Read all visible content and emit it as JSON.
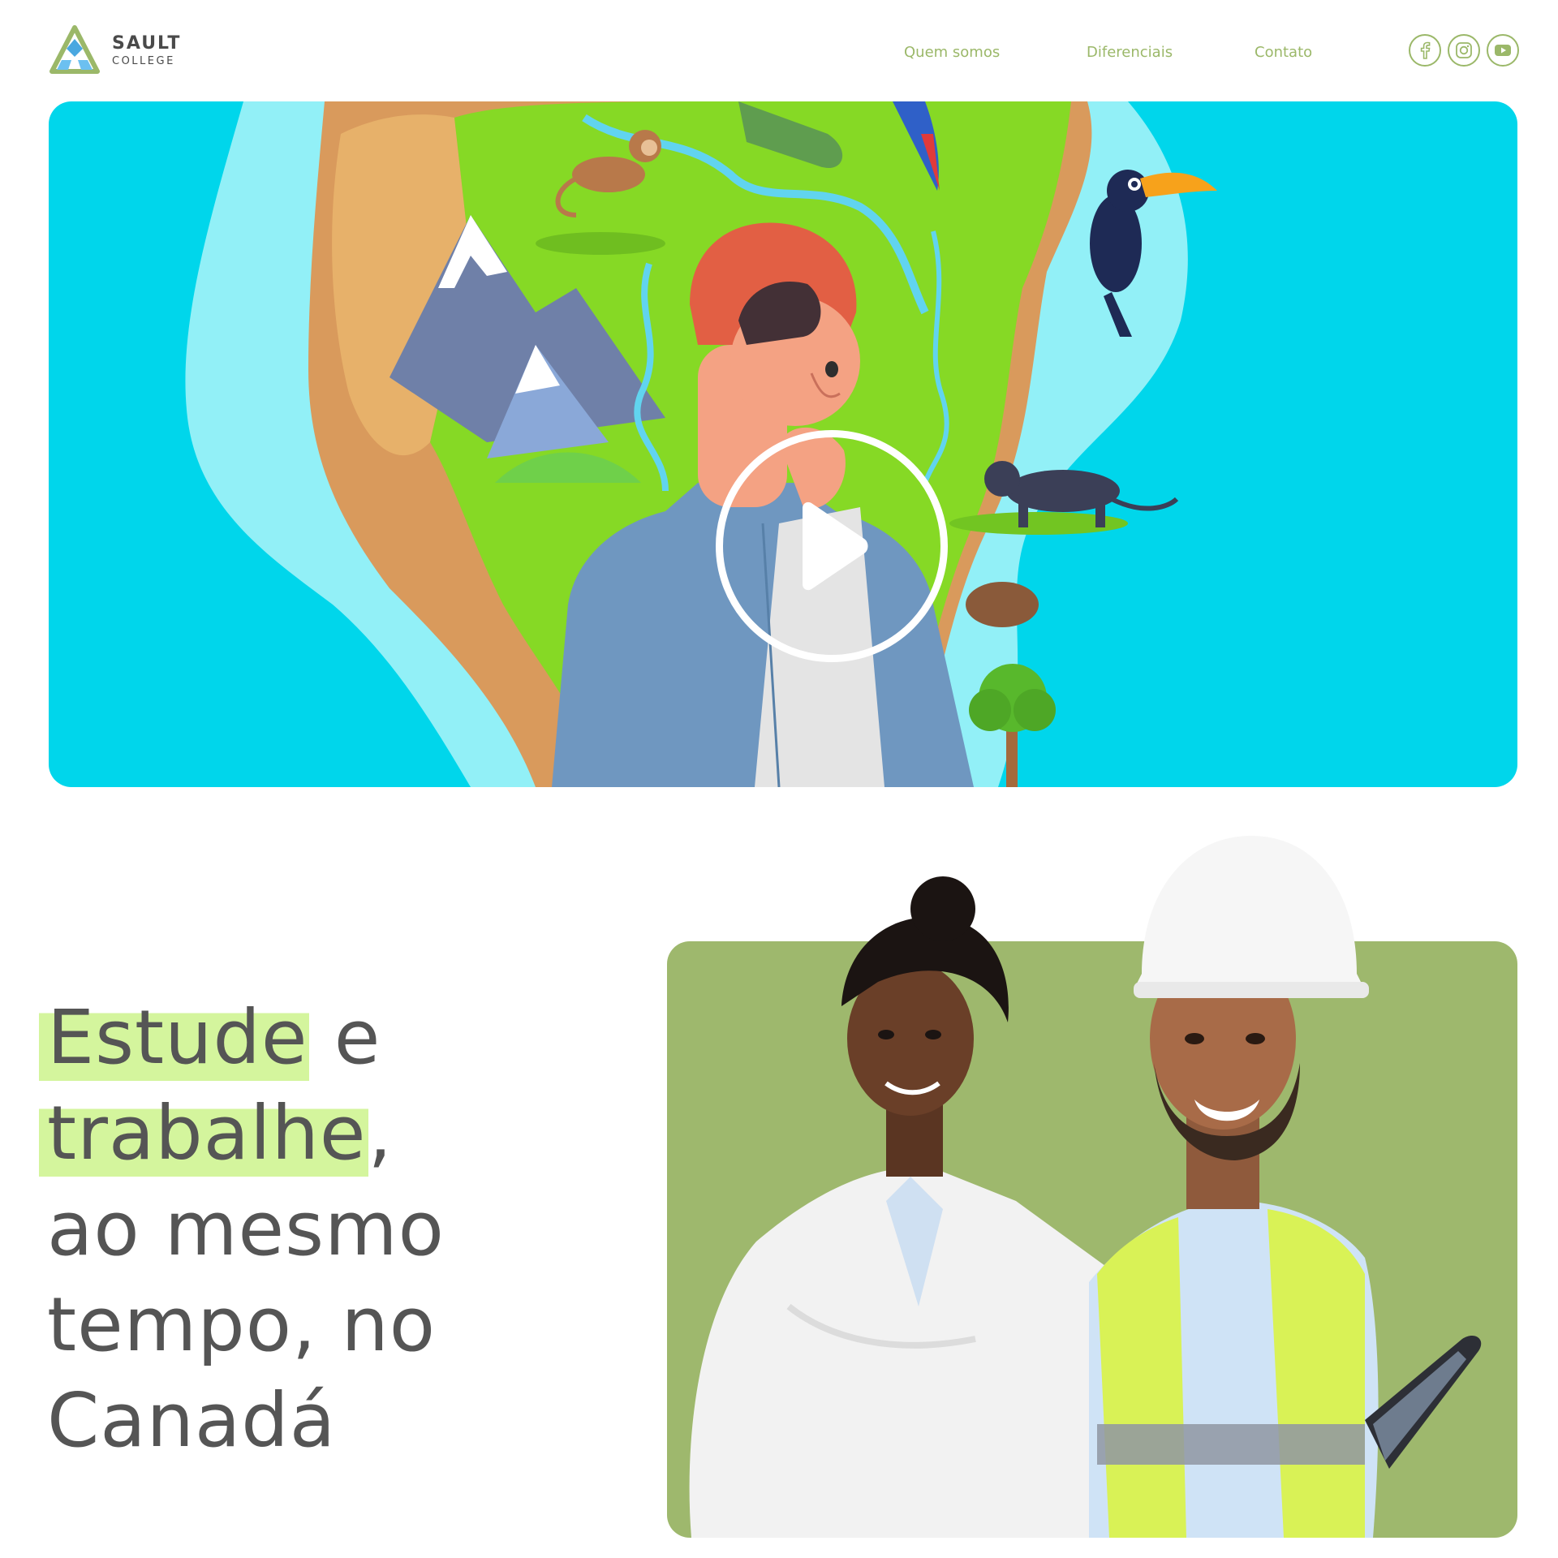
{
  "brand": {
    "name": "SAULT",
    "sub": "COLLEGE"
  },
  "nav": {
    "items": [
      {
        "label": "Quem somos"
      },
      {
        "label": "Diferenciais"
      },
      {
        "label": "Contato"
      }
    ]
  },
  "social": {
    "icons": [
      "facebook-icon",
      "instagram-icon",
      "youtube-icon"
    ],
    "color": "#9bb869"
  },
  "hero": {
    "background": "#00d6eb",
    "control": "play-icon"
  },
  "headline": {
    "word1": "Estude",
    "word2": " e",
    "word3": "trabalhe",
    "punct": ",",
    "line3": "ao mesmo",
    "line4": "tempo, no",
    "line5": "Canadá"
  },
  "colors": {
    "accent": "#9bb869",
    "highlight": "#d4f59d",
    "card": "#9eb86d",
    "text": "#555555"
  }
}
